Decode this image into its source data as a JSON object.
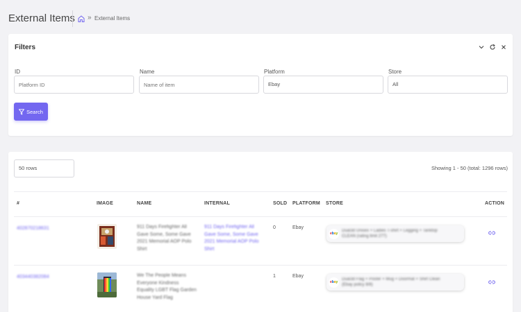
{
  "header": {
    "page_title": "External Items",
    "breadcrumb_separator": "»",
    "breadcrumb_current": "External Items"
  },
  "filters": {
    "title": "Filters",
    "fields": [
      {
        "label": "ID",
        "value": "",
        "placeholder": "Platform ID"
      },
      {
        "label": "Name",
        "value": "",
        "placeholder": "Name of item"
      },
      {
        "label": "Platform",
        "value": "Ebay",
        "placeholder": ""
      },
      {
        "label": "Store",
        "value": "All",
        "placeholder": ""
      }
    ],
    "search_label": "Search"
  },
  "results": {
    "rows_select": "50 rows",
    "showing": "Showing 1 - 50 (total: 1296 rows)",
    "columns": [
      "#",
      "IMAGE",
      "NAME",
      "INTERNAL",
      "SOLD",
      "PLATFORM",
      "STORE",
      "ACTION"
    ],
    "rows": [
      {
        "id": "402870218631",
        "name_lines": [
          "911 Days Firefighter All",
          "Gave Some, Some Gave",
          "2021 Memorial AOP Polo",
          "Shirt"
        ],
        "internal_lines": [
          "911 Days Firefighter All",
          "Gave Some, Some Gave",
          "2021 Memorial AOP Polo",
          "Shirt"
        ],
        "sold": "0",
        "platform": "Ebay",
        "store_lines": [
          "Dual3d Unisex + Ladies T-shirt + Legging + Tanktop",
          "CLEAN (rating limit 277)"
        ]
      },
      {
        "id": "403440382084",
        "name_lines": [
          "We The People Means",
          "Everyone Kindness",
          "Equality LGBT Flag Garden",
          "House Yard Flag"
        ],
        "internal_lines": [],
        "sold": "1",
        "platform": "Ebay",
        "store_lines": [
          "Dual3d Flag + Poster + Mug + Doormat + Shirt Clean",
          "(Ebay policy 8/8)"
        ]
      }
    ]
  },
  "colors": {
    "accent": "#7367f0",
    "background": "#f2f2f5"
  }
}
